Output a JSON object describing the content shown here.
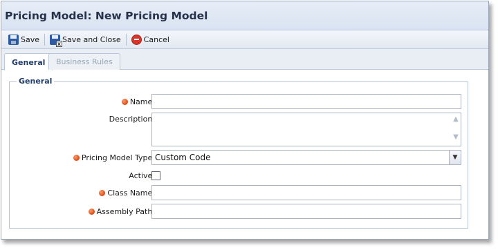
{
  "window": {
    "title": "Pricing Model: New Pricing Model"
  },
  "toolbar": {
    "save_label": "Save",
    "save_close_label": "Save and Close",
    "cancel_label": "Cancel"
  },
  "tabs": [
    {
      "label": "General",
      "active": true
    },
    {
      "label": "Business Rules",
      "active": false
    }
  ],
  "form": {
    "group_title": "General",
    "fields": {
      "name": {
        "label": "Name:",
        "required": true,
        "value": ""
      },
      "description": {
        "label": "Description:",
        "required": false,
        "value": ""
      },
      "pricing_model_type": {
        "label": "Pricing Model Type:",
        "required": true,
        "value": "Custom Code"
      },
      "active": {
        "label": "Active:",
        "required": false,
        "checked": false
      },
      "class_name": {
        "label": "Class Name:",
        "required": true,
        "value": ""
      },
      "assembly_path": {
        "label": "Assembly Path:",
        "required": true,
        "value": ""
      }
    }
  },
  "colors": {
    "title_text": "#25324a",
    "accent": "#1f3d6b",
    "required_dot": "#e0541e"
  }
}
